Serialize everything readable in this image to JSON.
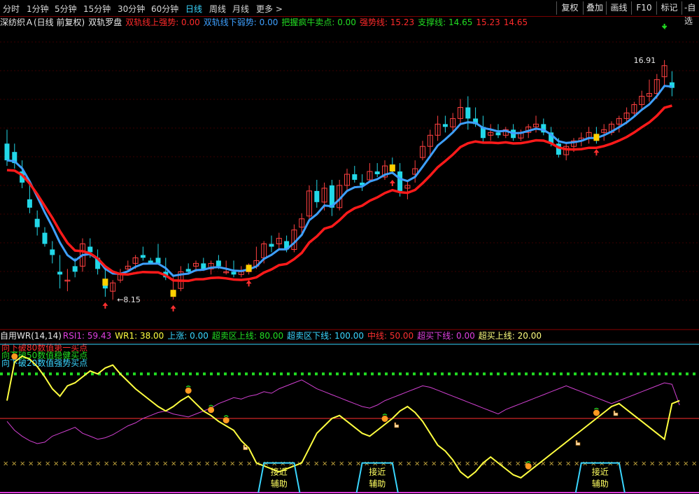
{
  "toolbar": {
    "periods": [
      "分时",
      "1分钟",
      "5分钟",
      "15分钟",
      "30分钟",
      "60分钟",
      "日线",
      "周线",
      "月线",
      "更多 >"
    ],
    "active_period": "日线",
    "buttons": [
      "复权",
      "叠加",
      "画线",
      "F10",
      "标记",
      "-自选"
    ]
  },
  "header": {
    "stock": "深纺织Ａ(日线 前复权)",
    "indicator": "双轨罗盘",
    "items": [
      {
        "label": "双轨线上强势:",
        "value": "0.00",
        "color": "#ff2a2a"
      },
      {
        "label": "双轨线下弱势:",
        "value": "0.00",
        "color": "#3ea0ff"
      },
      {
        "label": "把握疯牛卖点:",
        "value": "0.00",
        "color": "#22dd22"
      },
      {
        "label": "强势线:",
        "value": "15.23",
        "color": "#ff2a2a"
      },
      {
        "label": "支撑线:",
        "value": "14.65",
        "color": "#22dd22"
      },
      {
        "label": "",
        "value": "15.23",
        "color": "#ff2a2a"
      },
      {
        "label": "",
        "value": "14.65",
        "color": "#ff2a2a"
      }
    ]
  },
  "chart_data": {
    "type": "candlestick",
    "price_annotations": {
      "high": "16.91",
      "low": "8.15"
    },
    "ylim": [
      7.5,
      17.8
    ],
    "candles": [
      [
        13.9,
        14.4,
        13.1,
        13.3
      ],
      [
        13.6,
        13.9,
        13.0,
        13.2
      ],
      [
        12.9,
        13.3,
        12.3,
        12.5
      ],
      [
        11.9,
        12.5,
        11.4,
        11.6
      ],
      [
        11.2,
        11.5,
        10.6,
        10.9
      ],
      [
        10.7,
        10.9,
        10.2,
        10.3
      ],
      [
        10.1,
        10.4,
        9.6,
        9.9
      ],
      [
        9.3,
        9.9,
        8.7,
        9.2
      ],
      [
        9.0,
        9.4,
        8.6,
        9.0
      ],
      [
        9.5,
        9.8,
        9.1,
        9.3
      ],
      [
        9.5,
        10.5,
        9.3,
        10.3
      ],
      [
        10.2,
        10.5,
        9.8,
        10.0
      ],
      [
        9.8,
        10.1,
        9.2,
        9.4
      ],
      [
        9.0,
        9.4,
        8.4,
        8.7
      ],
      [
        8.6,
        9.0,
        8.3,
        8.9
      ],
      [
        9.0,
        9.4,
        8.9,
        9.2
      ],
      [
        9.4,
        9.7,
        9.3,
        9.5
      ],
      [
        9.6,
        9.9,
        9.4,
        9.8
      ],
      [
        9.9,
        10.2,
        9.7,
        9.8
      ],
      [
        9.7,
        9.8,
        9.6,
        9.6
      ],
      [
        9.8,
        10.3,
        9.7,
        9.6
      ],
      [
        9.3,
        9.8,
        9.0,
        9.1
      ],
      [
        8.5,
        9.1,
        8.3,
        8.6
      ],
      [
        8.7,
        9.5,
        8.6,
        9.3
      ],
      [
        9.4,
        9.6,
        9.2,
        9.3
      ],
      [
        9.5,
        9.7,
        9.3,
        9.6
      ],
      [
        9.6,
        9.8,
        9.5,
        9.4
      ],
      [
        9.4,
        9.7,
        9.2,
        9.6
      ],
      [
        9.7,
        9.9,
        9.4,
        9.5
      ],
      [
        9.3,
        9.7,
        9.2,
        9.3
      ],
      [
        9.3,
        9.7,
        9.1,
        9.2
      ],
      [
        9.2,
        9.5,
        9.1,
        9.3
      ],
      [
        9.3,
        9.6,
        9.2,
        9.5
      ],
      [
        9.5,
        10.2,
        9.4,
        9.7
      ],
      [
        9.8,
        10.4,
        9.6,
        10.3
      ],
      [
        10.3,
        10.6,
        10.0,
        10.2
      ],
      [
        10.3,
        10.7,
        10.1,
        10.5
      ],
      [
        10.4,
        10.6,
        10.0,
        10.1
      ],
      [
        10.1,
        11.0,
        10.0,
        10.8
      ],
      [
        10.9,
        11.4,
        10.7,
        11.2
      ],
      [
        11.3,
        12.4,
        11.2,
        12.2
      ],
      [
        12.2,
        12.6,
        11.6,
        11.8
      ],
      [
        11.8,
        12.5,
        11.5,
        12.3
      ],
      [
        12.4,
        12.6,
        11.3,
        11.6
      ],
      [
        11.6,
        12.6,
        11.5,
        12.4
      ],
      [
        12.4,
        13.0,
        12.2,
        12.8
      ],
      [
        12.8,
        13.1,
        12.5,
        12.6
      ],
      [
        12.5,
        12.8,
        12.2,
        12.4
      ],
      [
        12.6,
        13.2,
        12.5,
        12.9
      ],
      [
        12.9,
        13.2,
        12.7,
        12.8
      ],
      [
        12.7,
        13.3,
        12.6,
        13.1
      ],
      [
        13.1,
        13.4,
        12.8,
        13.0
      ],
      [
        12.9,
        13.2,
        12.0,
        12.2
      ],
      [
        12.3,
        12.6,
        11.9,
        12.4
      ],
      [
        12.8,
        13.3,
        12.5,
        13.0
      ],
      [
        13.4,
        14.0,
        13.3,
        13.8
      ],
      [
        13.8,
        14.4,
        13.5,
        14.2
      ],
      [
        14.2,
        14.9,
        14.0,
        14.6
      ],
      [
        14.6,
        14.9,
        14.3,
        14.5
      ],
      [
        14.5,
        15.0,
        14.3,
        14.8
      ],
      [
        14.8,
        15.5,
        14.6,
        15.2
      ],
      [
        15.2,
        15.6,
        14.4,
        14.8
      ],
      [
        14.8,
        15.2,
        14.5,
        14.6
      ],
      [
        14.5,
        14.9,
        13.9,
        14.1
      ],
      [
        14.2,
        14.6,
        14.0,
        14.3
      ],
      [
        14.3,
        14.6,
        14.1,
        14.2
      ],
      [
        14.2,
        14.5,
        14.1,
        14.4
      ],
      [
        14.4,
        14.6,
        14.0,
        14.1
      ],
      [
        14.1,
        14.4,
        14.0,
        14.3
      ],
      [
        14.3,
        14.6,
        14.1,
        14.5
      ],
      [
        14.5,
        14.9,
        14.3,
        14.6
      ],
      [
        14.6,
        14.8,
        14.2,
        14.3
      ],
      [
        14.3,
        14.5,
        13.8,
        13.9
      ],
      [
        13.9,
        14.1,
        13.4,
        13.5
      ],
      [
        13.5,
        13.9,
        13.3,
        13.8
      ],
      [
        13.8,
        14.1,
        13.6,
        14.0
      ],
      [
        14.0,
        14.3,
        13.8,
        14.1
      ],
      [
        14.1,
        14.5,
        13.9,
        14.3
      ],
      [
        14.2,
        14.5,
        13.9,
        14.1
      ],
      [
        14.3,
        14.6,
        14.0,
        14.4
      ],
      [
        14.3,
        14.7,
        14.2,
        14.6
      ],
      [
        14.6,
        14.9,
        14.3,
        14.8
      ],
      [
        14.8,
        15.2,
        14.6,
        15.0
      ],
      [
        15.0,
        15.4,
        14.9,
        15.3
      ],
      [
        15.3,
        15.8,
        15.1,
        15.6
      ],
      [
        15.6,
        16.2,
        15.4,
        15.7
      ],
      [
        15.7,
        16.4,
        15.5,
        16.2
      ],
      [
        16.3,
        16.9,
        16.0,
        16.7
      ],
      [
        16.1,
        16.5,
        15.6,
        15.9
      ]
    ]
  },
  "indicator": {
    "title": "自用WR(14,14)",
    "items": [
      {
        "label": "RSI1:",
        "value": "59.43",
        "color": "#e040e0"
      },
      {
        "label": "WR1:",
        "value": "38.00",
        "color": "#ffff40"
      },
      {
        "label": "上涨:",
        "value": "0.00",
        "color": "#3ad6ff"
      },
      {
        "label": "超卖区上线:",
        "value": "80.00",
        "color": "#22dd22"
      },
      {
        "label": "超卖区下线:",
        "value": "100.00",
        "color": "#3ad6ff"
      },
      {
        "label": "中线:",
        "value": "50.00",
        "color": "#ff3030"
      },
      {
        "label": "超买下线:",
        "value": "0.00",
        "color": "#e040e0"
      },
      {
        "label": "超买上线:",
        "value": "20.00",
        "color": "#ffff80"
      }
    ],
    "legend": [
      {
        "text": "向下破80数值第一买点",
        "color": "#ff3030"
      },
      {
        "text": "向下破50数值稳健买点",
        "color": "#22dd22"
      },
      {
        "text": "向下破20数值强势买点",
        "color": "#3ad6ff"
      }
    ],
    "assist_label_1": "接近",
    "assist_label_2": "辅助",
    "rsi": [
      48,
      42,
      38,
      35,
      33,
      34,
      38,
      40,
      42,
      44,
      40,
      38,
      36,
      37,
      39,
      42,
      45,
      47,
      50,
      52,
      54,
      55,
      53,
      52,
      51,
      53,
      55,
      57,
      60,
      62,
      64,
      63,
      65,
      66,
      68,
      67,
      70,
      72,
      74,
      76,
      73,
      70,
      68,
      66,
      64,
      62,
      60,
      58,
      57,
      59,
      62,
      64,
      66,
      68,
      70,
      72,
      71,
      69,
      67,
      65,
      63,
      61,
      59,
      57,
      55,
      53,
      56,
      58,
      60,
      62,
      64,
      66,
      68,
      70,
      72,
      70,
      68,
      66,
      64,
      62,
      60,
      62,
      64,
      66,
      68,
      70,
      72,
      74,
      73,
      59
    ],
    "wr": [
      38,
      12,
      8,
      10,
      15,
      22,
      30,
      35,
      28,
      26,
      22,
      18,
      20,
      16,
      14,
      20,
      25,
      30,
      34,
      38,
      42,
      45,
      42,
      38,
      35,
      40,
      45,
      48,
      52,
      55,
      58,
      65,
      70,
      80,
      82,
      84,
      86,
      84,
      82,
      80,
      70,
      60,
      55,
      50,
      48,
      52,
      56,
      60,
      62,
      58,
      54,
      50,
      45,
      42,
      46,
      52,
      60,
      68,
      72,
      78,
      86,
      90,
      86,
      80,
      76,
      80,
      84,
      88,
      90,
      86,
      82,
      78,
      74,
      70,
      66,
      62,
      58,
      54,
      50,
      46,
      42,
      40,
      44,
      48,
      52,
      56,
      60,
      64,
      40,
      38
    ],
    "wr_note": "",
    "assist_windows": [
      [
        34,
        38
      ],
      [
        47,
        51
      ],
      [
        76,
        81
      ]
    ]
  }
}
